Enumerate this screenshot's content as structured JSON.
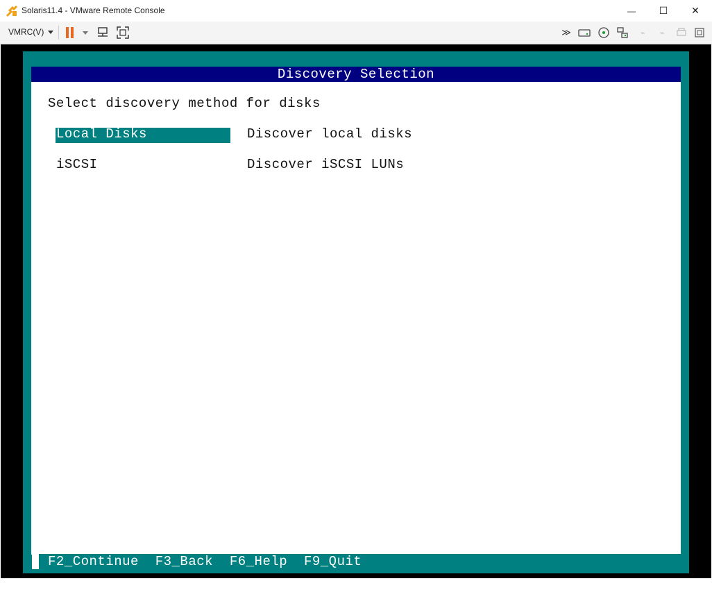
{
  "window": {
    "title": "Solaris11.4 - VMware Remote Console",
    "controls": {
      "minimize": "—",
      "maximize": "☐",
      "close": "✕"
    }
  },
  "toolbar": {
    "vmrc_menu": "VMRC(V)",
    "accent": "#e8681f"
  },
  "screen": {
    "header": "Discovery Selection",
    "prompt": "Select discovery method for disks",
    "options": [
      {
        "label": "Local Disks",
        "description": "Discover local disks",
        "selected": true
      },
      {
        "label": "iSCSI",
        "description": "Discover iSCSI LUNs",
        "selected": false
      }
    ],
    "footer": "F2_Continue  F3_Back  F6_Help  F9_Quit"
  },
  "colors": {
    "header_bg": "#000080",
    "frame_teal": "#008080",
    "console_bg": "#000000"
  }
}
